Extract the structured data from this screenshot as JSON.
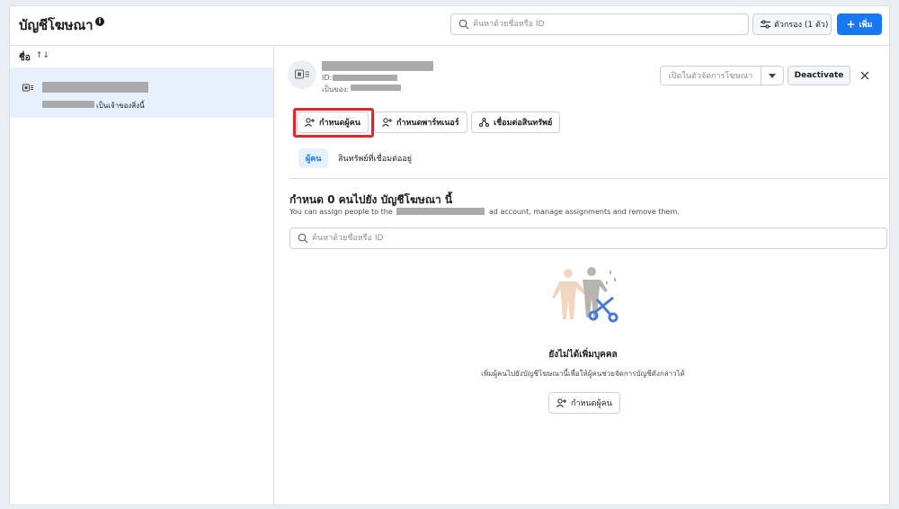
{
  "header": {
    "title": "บัญชีโฆษณา",
    "search_placeholder": "ค้นหาด้วยชื่อหรือ ID",
    "filter_label": "ตัวกรอง (1 ตัว)",
    "add_label": "เพิ่ม"
  },
  "list": {
    "column_name": "ชื่อ",
    "sort_icon": "↑↓",
    "items": [
      {
        "owner_label": "เป็นเจ้าของสิ่งนี้"
      }
    ]
  },
  "detail": {
    "id_label": "ID:",
    "owned_by_label": "เป็นของ:",
    "open_manager_label": "เปิดในตัวจัดการโฆษณา",
    "deactivate_label": "Deactivate",
    "actions": {
      "assign_people": "กำหนดผู้คน",
      "assign_partner": "กำหนดพาร์ทเนอร์",
      "connect_assets": "เชื่อมต่อสินทรัพย์"
    },
    "tabs": {
      "people": "ผู้คน",
      "connected_assets": "สินทรัพย์ที่เชื่อมต่ออยู่"
    },
    "assign_title": "กำหนด 0 คนไปยัง บัญชีโฆษณา นี้",
    "assign_desc_prefix": "You can assign people to the",
    "assign_desc_suffix": "ad account, manage assignments and remove them.",
    "people_search_placeholder": "ค้นหาด้วยชื่อหรือ ID",
    "empty_title": "ยังไม่ได้เพิ่มบุคคล",
    "empty_desc": "เพิ่มผู้คนไปยังบัญชีโฆษณานี้เพื่อให้ผู้คนช่วยจัดการบัญชีดังกล่าวได้",
    "empty_button": "กำหนดผู้คน"
  },
  "colors": {
    "accent": "#1877f2",
    "highlight": "#e4232a",
    "selected_bg": "#e7f0fd"
  },
  "icons": [
    "info-icon",
    "search-icon",
    "filter-icon",
    "plus-icon",
    "ad-account-icon",
    "close-icon",
    "person-add-icon",
    "partner-add-icon",
    "connect-icon",
    "chevron-down-icon"
  ]
}
